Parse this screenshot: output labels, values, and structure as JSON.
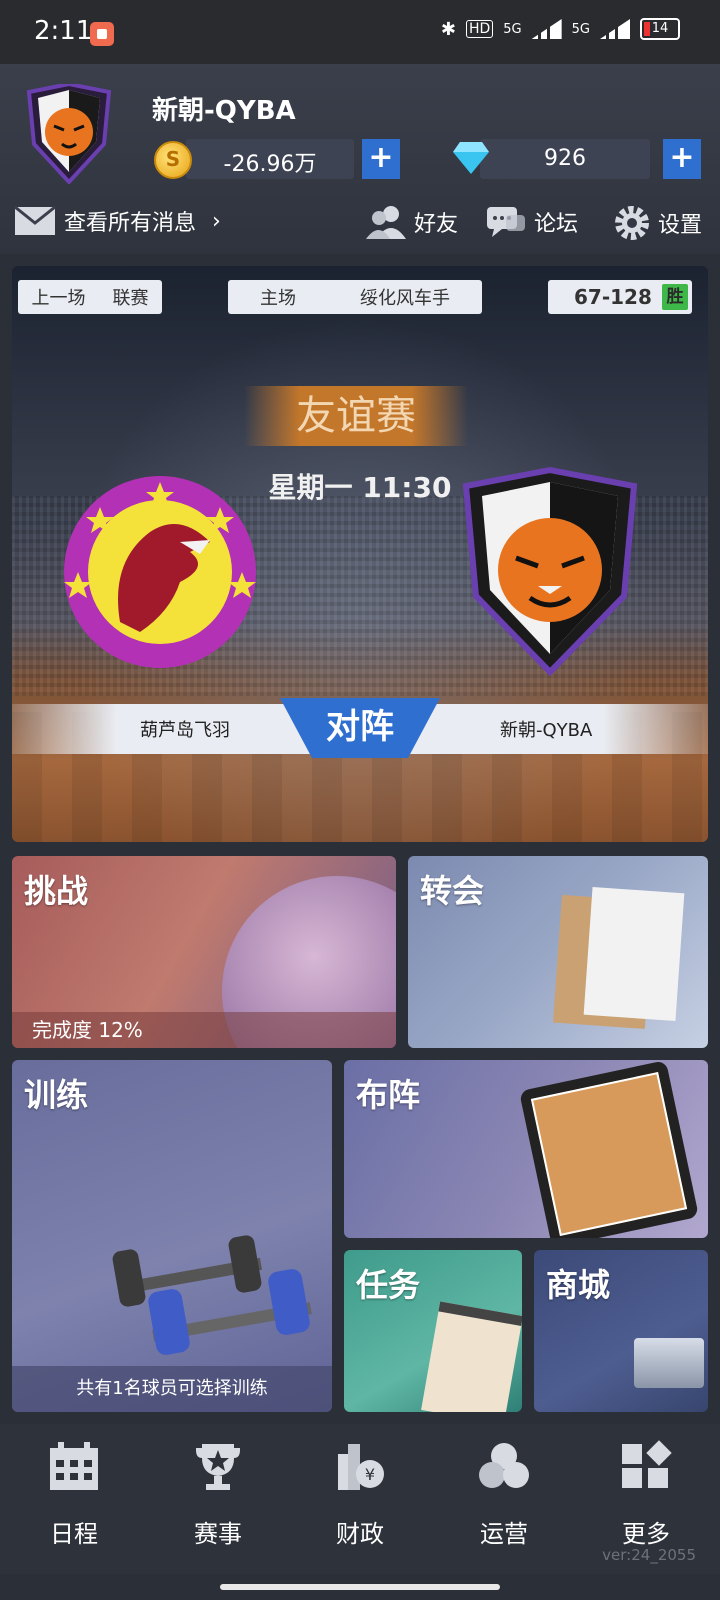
{
  "status_bar": {
    "time": "2:11",
    "network_1": "5G",
    "network_2": "5G",
    "hd": "HD",
    "battery": "14"
  },
  "team": {
    "name": "新朝-QYBA",
    "coins": "-26.96万",
    "diamonds": "926",
    "plus_symbol": "+"
  },
  "header_links": {
    "messages": "查看所有消息",
    "friends": "好友",
    "forum": "论坛",
    "settings": "设置"
  },
  "match": {
    "last_label": "上一场",
    "last_competition": "联赛",
    "venue": "主场",
    "opponent": "绥化风车手",
    "score": "67-128",
    "result": "胜",
    "type": "友谊赛",
    "time": "星期一 11:30",
    "home_team": "葫芦岛飞羽",
    "away_team": "新朝-QYBA",
    "vs_label": "对阵"
  },
  "tiles": {
    "challenge": "挑战",
    "challenge_progress": "完成度  12%",
    "transfer": "转会",
    "training": "训练",
    "training_note": "共有1名球员可选择训练",
    "formation": "布阵",
    "tasks": "任务",
    "shop": "商城"
  },
  "nav": [
    {
      "label": "日程",
      "icon": "calendar-icon"
    },
    {
      "label": "赛事",
      "icon": "trophy-icon"
    },
    {
      "label": "财政",
      "icon": "finance-icon"
    },
    {
      "label": "运营",
      "icon": "operations-icon"
    },
    {
      "label": "更多",
      "icon": "more-icon"
    }
  ],
  "version": "ver:24_2055",
  "colors": {
    "accent_blue": "#2f6fd0",
    "win_green": "#3fb84a",
    "background": "#2b2f38"
  }
}
